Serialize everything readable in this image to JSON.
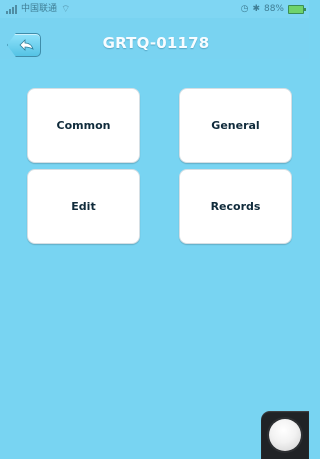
{
  "status_bar": {
    "carrier": "中国联通",
    "battery_text": "88%",
    "signal_icon": "signal-bars-icon",
    "wifi_icon": "wifi-icon",
    "clock_icon": "clock-icon",
    "bluetooth_icon": "bluetooth-icon",
    "battery_icon": "battery-icon"
  },
  "header": {
    "back_icon": "back-arrow-icon",
    "title": "GRTQ-01178"
  },
  "menu": {
    "common_label": "Common",
    "general_label": "General",
    "edit_label": "Edit",
    "records_label": "Records"
  },
  "floating_control": {
    "icon": "assistive-touch-icon"
  },
  "colors": {
    "background": "#78d4f2",
    "button_background": "#ffffff",
    "title_text": "#f8fcff",
    "button_text": "#102b3b"
  }
}
